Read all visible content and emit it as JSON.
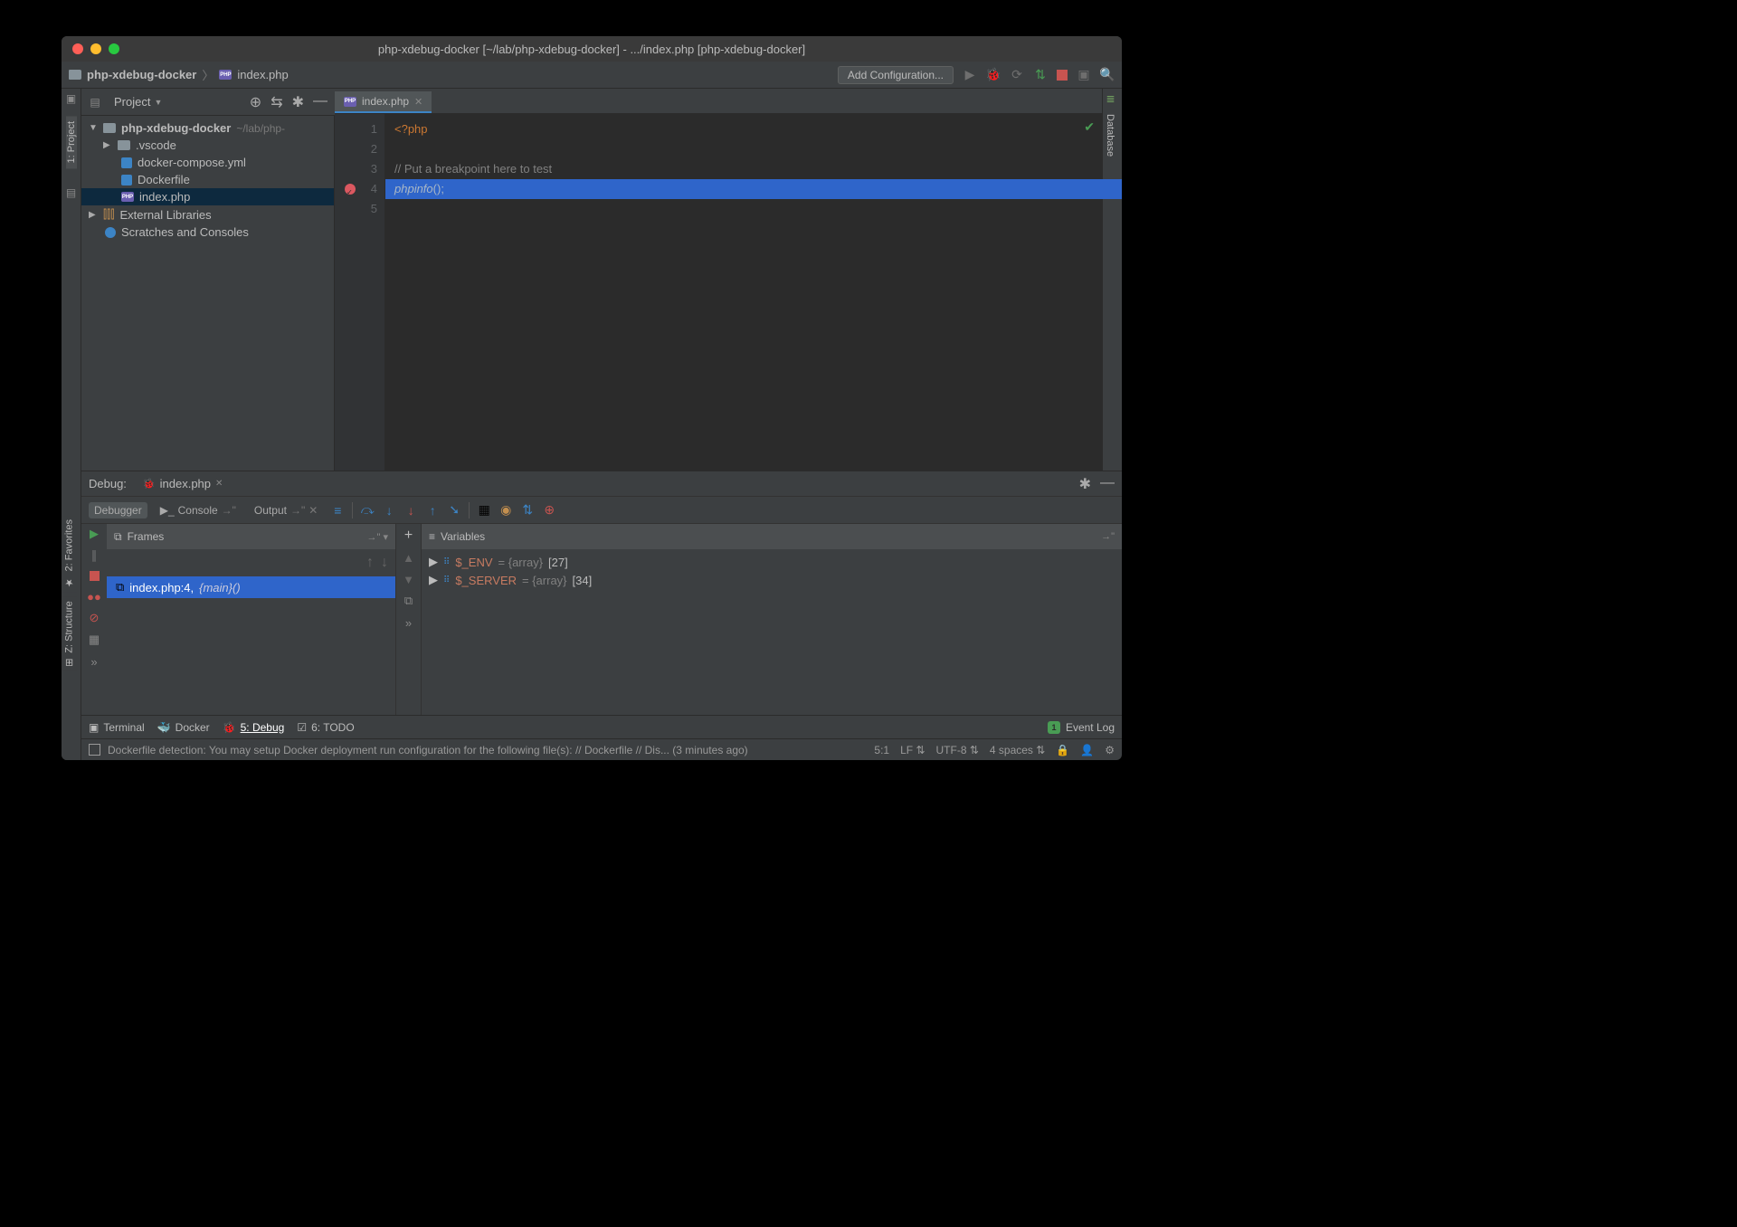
{
  "titlebar": "php-xdebug-docker [~/lab/php-xdebug-docker] - .../index.php [php-xdebug-docker]",
  "breadcrumb": {
    "root": "php-xdebug-docker",
    "file": "index.php"
  },
  "toolbar": {
    "add_config": "Add Configuration..."
  },
  "left_gutter": {
    "project": "1: Project"
  },
  "project": {
    "label": "Project",
    "root_name": "php-xdebug-docker",
    "root_path": "~/lab/php-",
    "items": {
      "vscode": ".vscode",
      "compose": "docker-compose.yml",
      "dockerfile": "Dockerfile",
      "index": "index.php",
      "extlib": "External Libraries",
      "scratches": "Scratches and Consoles"
    }
  },
  "editor": {
    "tab": "index.php",
    "lines": [
      "1",
      "2",
      "3",
      "4",
      "5"
    ],
    "code": {
      "l1": "<?php",
      "l3": "// Put a breakpoint here to test",
      "l4a": "phpinfo",
      "l4b": "();"
    }
  },
  "right_gutter": {
    "database": "Database"
  },
  "debug": {
    "label": "Debug:",
    "tab": "index.php",
    "subtabs": {
      "debugger": "Debugger",
      "console": "Console",
      "output": "Output"
    },
    "frames": {
      "title": "Frames",
      "item_file": "index.php:4,",
      "item_fn": "{main}()"
    },
    "vars": {
      "title": "Variables",
      "rows": [
        {
          "name": "$_ENV",
          "type": " = {array}",
          "count": "[27]"
        },
        {
          "name": "$_SERVER",
          "type": " = {array}",
          "count": "[34]"
        }
      ]
    }
  },
  "bottom_tabs": {
    "terminal": "Terminal",
    "docker": "Docker",
    "debug": "5: Debug",
    "todo": "6: TODO",
    "event_log": "Event Log"
  },
  "status": {
    "msg": "Dockerfile detection: You may setup Docker deployment run configuration for the following file(s): // Dockerfile // Dis... (3 minutes ago)",
    "pos": "5:1",
    "le": "LF",
    "enc": "UTF-8",
    "indent": "4 spaces"
  },
  "left_tabs": {
    "favorites": "2: Favorites",
    "structure": "Z: Structure"
  }
}
